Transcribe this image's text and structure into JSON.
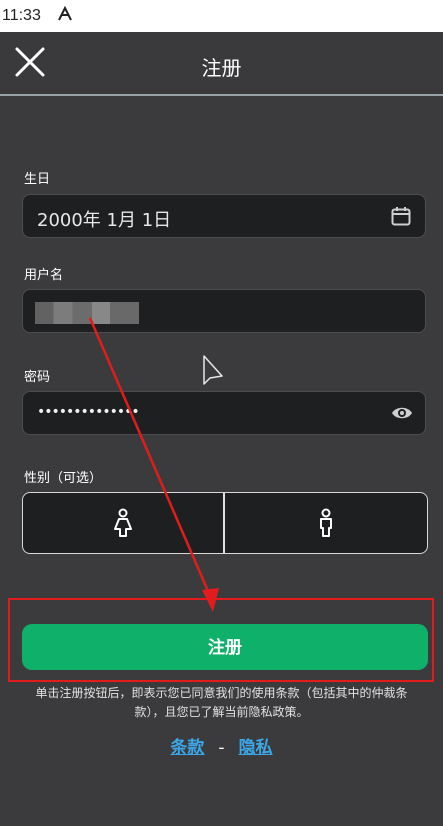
{
  "status_bar": {
    "time": "11:33",
    "notification_icon": "a-icon"
  },
  "header": {
    "title": "注册",
    "close_icon": "close-icon"
  },
  "form": {
    "birthday": {
      "label": "生日",
      "value": "2000年 1月 1日",
      "icon": "calendar-icon"
    },
    "username": {
      "label": "用户名",
      "value_redacted": true
    },
    "password": {
      "label": "密码",
      "value": "••••••••••••••",
      "icon": "eye-icon"
    },
    "gender": {
      "label": "性别（可选）",
      "options": [
        "female-icon",
        "male-icon"
      ]
    }
  },
  "submit": {
    "label": "注册"
  },
  "terms_text": "单击注册按钮后，即表示您已同意我们的使用条款（包括其中的仲裁条款），且您已了解当前隐私政策。",
  "links": {
    "terms": "条款",
    "separator": "-",
    "privacy": "隐私"
  },
  "colors": {
    "accent": "#0fb06a",
    "link": "#3ba6e8",
    "annotation": "#e21c1c",
    "background": "#3b3b3d"
  }
}
